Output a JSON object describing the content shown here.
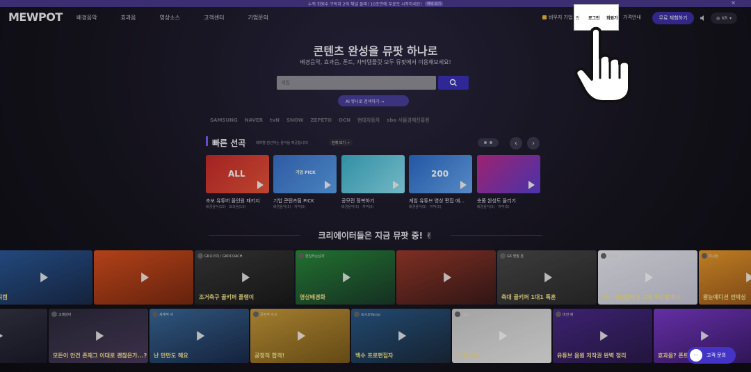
{
  "banner": {
    "text": "누적 회원수 구독자 2억 채널 돌파! 10초만에 무료로 시작하세요!",
    "pill": "혜택 보기"
  },
  "nav": {
    "logo": "MEWPOT",
    "menu": [
      "배경음악",
      "효과음",
      "영상소스",
      "고객센터",
      "기업문의"
    ],
    "biz": "비우지 기업",
    "biz_extra": "인",
    "login": "로그인",
    "signup": "회원가",
    "price": "가격안내",
    "trial": "무료 체험하기",
    "lang": "KR"
  },
  "hero": {
    "title": "콘텐츠 완성을 뮤팟 하나로",
    "subtitle": "배경음악, 효과음, 폰트, 자막템플릿 모두 뮤팟에서 이용해보세요!",
    "search_placeholder": "게임",
    "ai_button": "AI 뮤니로 검색하기 →",
    "brands": [
      "SAMSUNG",
      "NAVER",
      "tvN",
      "SNOW",
      "ZEPETO",
      "OCN",
      "현대자동차",
      "sba 서울경제진흥원"
    ]
  },
  "quick": {
    "title": "빠른 선곡",
    "desc": "테마별 엄선하는 음악을 제공합니다!",
    "all": "전체 보기 ↗",
    "cards": [
      {
        "title": "초보 유튜버 올인원 패키지",
        "meta": "배경음악(10) · 효과음(10)",
        "color1": "#c62a2a",
        "color2": "#e8543a",
        "badge": "ALL"
      },
      {
        "title": "기업 콘텐츠팀 PICK",
        "meta": "배경음악(5) · 자막(5)",
        "color1": "#3a6fc8",
        "color2": "#5aa0e8",
        "badge": "기업 PICK"
      },
      {
        "title": "공모전 정복하기",
        "meta": "배경음악(5) · 자막(5)",
        "color1": "#3bb0c8",
        "color2": "#8ee0f0",
        "badge": ""
      },
      {
        "title": "게임 유튜브 영상 편집 에...",
        "meta": "배경음악(5) · 자막(5)",
        "color1": "#2a6ac8",
        "color2": "#6aa8f0",
        "badge": "200"
      },
      {
        "title": "숏폼 완성도 올리기",
        "meta": "배경음악(5) · 자막(5)",
        "color1": "#c02a8a",
        "color2": "#5a3fd0",
        "badge": ""
      }
    ]
  },
  "creators": {
    "title": "크리에이터들은 지금 뮤팟 중! ✌",
    "row1": [
      {
        "cap": "직캠",
        "ch": "",
        "c1": "#2a5a9a",
        "c2": "#1a2a4a"
      },
      {
        "cap": "",
        "ch": "",
        "c1": "#d9501f",
        "c2": "#7a2a10"
      },
      {
        "cap": "조거축구 골키퍼 플랭이",
        "ch": "GK오코치 / GKOCOACH",
        "c1": "#3a3a3a",
        "c2": "#1a1a1a"
      },
      {
        "cap": "영상배경화",
        "ch": "편집하는남자",
        "c1": "#2a8a3a",
        "c2": "#1a3a2a"
      },
      {
        "cap": "",
        "ch": "",
        "c1": "#9a3a2a",
        "c2": "#3a1a1a"
      },
      {
        "cap": "축대 골키퍼 1대1 특훈",
        "ch": "GK 맞말 훈",
        "c1": "#4a4a4a",
        "c2": "#2a2a2a"
      },
      {
        "cap": "아니 썸네일러아 그게 무슨말이니",
        "ch": "배호롱",
        "c1": "#e8e8f0",
        "c2": "#c8c8d8"
      },
      {
        "cap": "왕눈에디션 언박싱",
        "ch": "예시쌀",
        "c1": "#e89a2a",
        "c2": "#8a4a1a"
      },
      {
        "cap": "",
        "ch": "",
        "c1": "#7a3a8a",
        "c2": "#3a1a4a"
      }
    ],
    "row2": [
      {
        "cap": "",
        "ch": "",
        "c1": "#3a3a4a",
        "c2": "#1a1a2a"
      },
      {
        "cap": "모든이 안건 존재그 이대로 괜찮은가...?",
        "ch": "고래싱어",
        "c1": "#2a2a3a",
        "c2": "#4a3a5a"
      },
      {
        "cap": "난 만만도 해요",
        "ch": "세계적 서",
        "c1": "#3a6a9a",
        "c2": "#1a2a4a"
      },
      {
        "cap": "공정적 합격!",
        "ch": "공정적 사고",
        "c1": "#c89a3a",
        "c2": "#7a5a1a"
      },
      {
        "cap": "백수 프로편집자",
        "ch": "요시오Yocyo",
        "c1": "#2a5a8a",
        "c2": "#1a2a3a"
      },
      {
        "cap": "넌 좀 맞자",
        "ch": "냥세",
        "c1": "#c8c8c8",
        "c2": "#e8e8e8"
      },
      {
        "cap": "유튜브 음원 저작권 완벽 정리",
        "ch": "비전 에",
        "c1": "#4a2a8a",
        "c2": "#2a1a4a"
      },
      {
        "cap": "효과음? 폰트? 템플릿?",
        "ch": "",
        "c1": "#7a3ac8",
        "c2": "#3a1a6a"
      },
      {
        "cap": "",
        "ch": "",
        "c1": "#6a6a7a",
        "c2": "#2a2a3a"
      }
    ]
  },
  "chat": {
    "label": "고객 문의"
  },
  "icons": {
    "search": "search-icon",
    "volume": "volume-icon",
    "globe": "globe-icon",
    "pointer": "hand-pointer-icon"
  }
}
